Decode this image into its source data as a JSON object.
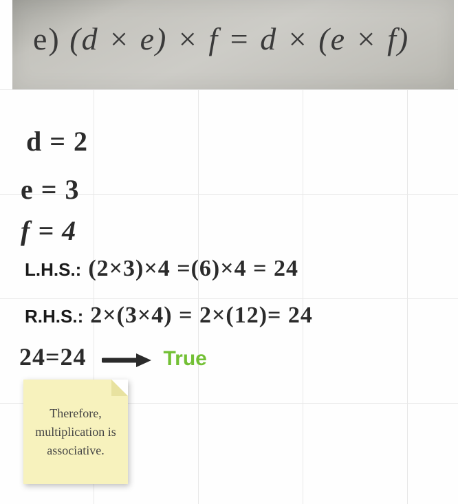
{
  "problem": {
    "label": "e)",
    "equation_text": "(d × e) × f = d × (e × f)"
  },
  "variables": {
    "d_text": "d = 2",
    "e_text": "e = 3",
    "f_text": "f = 4"
  },
  "lhs": {
    "label": "L.H.S.:",
    "work": "(2×3)×4 =(6)×4 = 24"
  },
  "rhs": {
    "label": "R.H.S.:",
    "work": "2×(3×4) = 2×(12)= 24"
  },
  "result": {
    "comparison": "24=24",
    "verdict": "True"
  },
  "note": {
    "text": "Therefore, multiplication is associative."
  },
  "colors": {
    "true_green": "#73c035",
    "sticky_bg": "#f7f2bd"
  }
}
